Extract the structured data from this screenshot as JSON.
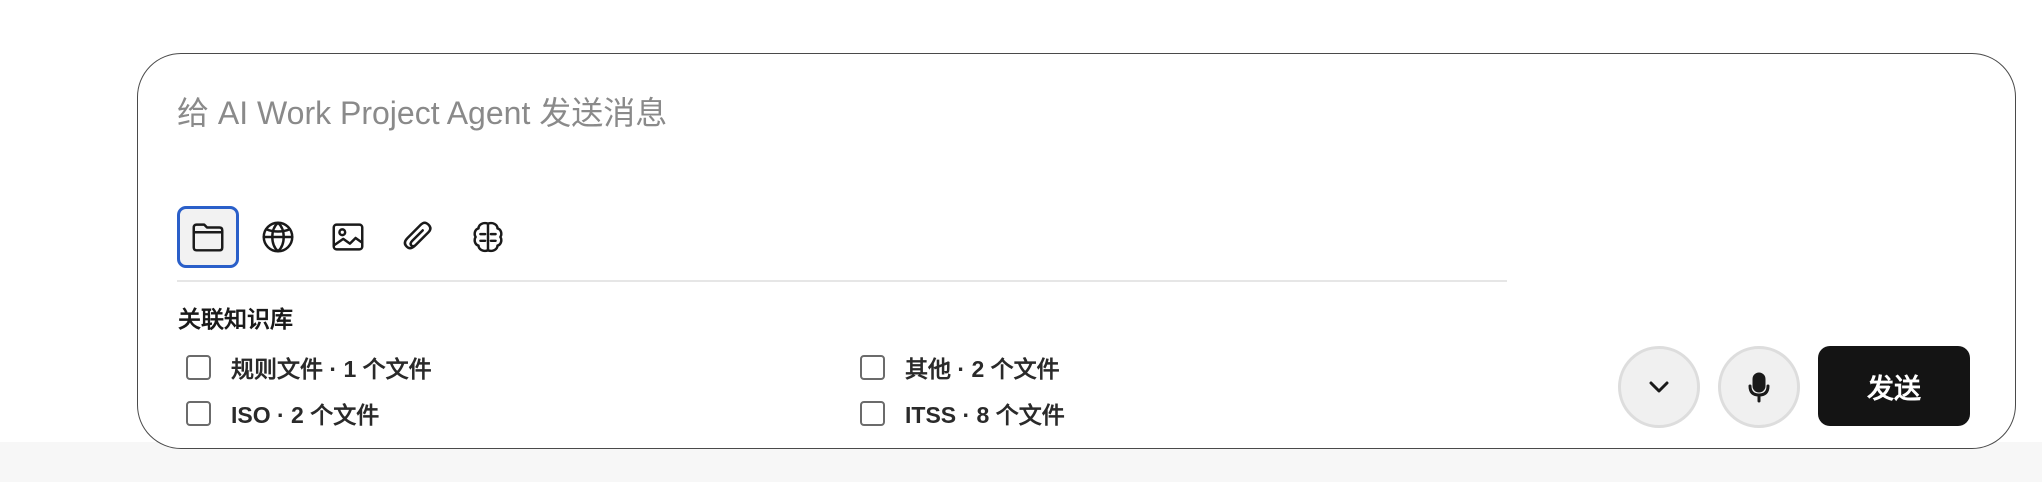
{
  "composer": {
    "placeholder": "给 AI Work Project Agent 发送消息",
    "value": ""
  },
  "toolbar": {
    "tools": [
      {
        "icon": "folder-icon",
        "active": true
      },
      {
        "icon": "globe-icon",
        "active": false
      },
      {
        "icon": "image-icon",
        "active": false
      },
      {
        "icon": "paperclip-icon",
        "active": false
      },
      {
        "icon": "brain-icon",
        "active": false
      }
    ]
  },
  "knowledge_base": {
    "title": "关联知识库",
    "items": [
      {
        "label": "规则文件 · 1 个文件",
        "checked": false
      },
      {
        "label": "其他 · 2 个文件",
        "checked": false
      },
      {
        "label": "ISO · 2 个文件",
        "checked": false
      },
      {
        "label": "ITSS · 8 个文件",
        "checked": false
      }
    ]
  },
  "actions": {
    "expand_icon": "chevron-down-icon",
    "mic_icon": "microphone-icon",
    "send_label": "发送"
  },
  "colors": {
    "send_button_bg": "#141414",
    "active_tool_border": "#2a5fc9",
    "composer_border": "#4a4a4a"
  }
}
